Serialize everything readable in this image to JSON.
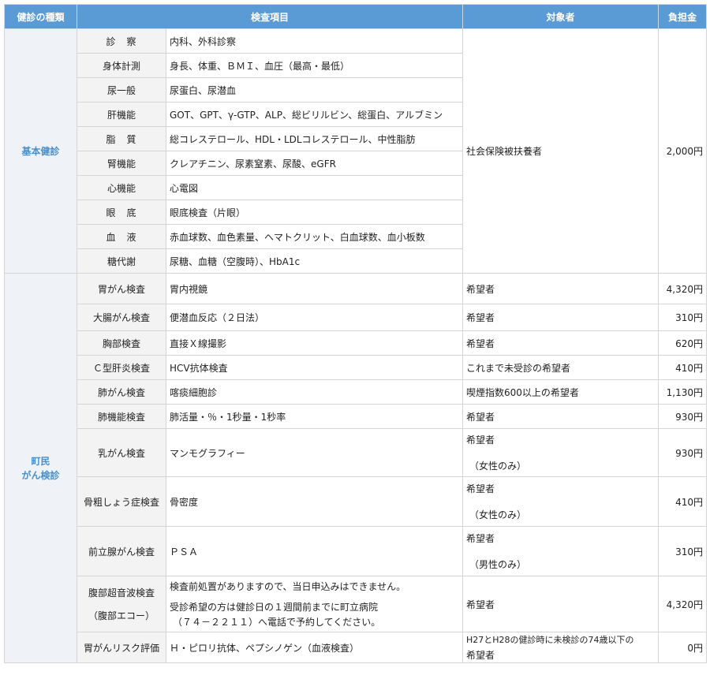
{
  "headers": {
    "type": "健診の種類",
    "item": "検査項目",
    "target": "対象者",
    "fee": "負担金"
  },
  "basic": {
    "category": "基本健診",
    "target": "社会保険被扶養者",
    "fee": "2,000円",
    "items": [
      {
        "name": "診　察",
        "detail": "内科、外科診察"
      },
      {
        "name": "身体計測",
        "detail": "身長、体重、ＢＭＩ、血圧（最高・最低）"
      },
      {
        "name": "尿一般",
        "detail": "尿蛋白、尿潜血"
      },
      {
        "name": "肝機能",
        "detail": "GOT、GPT、γ-GTP、ALP、総ビリルビン、総蛋白、アルブミン"
      },
      {
        "name": "脂　質",
        "detail": "総コレステロール、HDL・LDLコレステロール、中性脂肪"
      },
      {
        "name": "腎機能",
        "detail": "クレアチニン、尿素窒素、尿酸、eGFR"
      },
      {
        "name": "心機能",
        "detail": "心電図"
      },
      {
        "name": "眼　底",
        "detail": "眼底検査（片眼）"
      },
      {
        "name": "血　液",
        "detail": "赤血球数、血色素量、ヘマトクリット、白血球数、血小板数"
      },
      {
        "name": "糖代謝",
        "detail": "尿糖、血糖（空腹時）、HbA1c"
      }
    ]
  },
  "cancer": {
    "category_line1": "町民",
    "category_line2": "がん検診",
    "rows": [
      {
        "name": "胃がん検査",
        "detail": "胃内視鏡",
        "target": "希望者",
        "fee": "4,320円"
      },
      {
        "name": "大腸がん検査",
        "detail": "便潜血反応（２日法）",
        "target": "希望者",
        "fee": "310円"
      },
      {
        "name": "胸部検査",
        "detail": "直接Ｘ線撮影",
        "target": "希望者",
        "fee": "620円"
      },
      {
        "name": "Ｃ型肝炎検査",
        "detail": "HCV抗体検査",
        "target": "これまで未受診の希望者",
        "fee": "410円"
      },
      {
        "name": "肺がん検査",
        "detail": "喀痰細胞診",
        "target": "喫煙指数600以上の希望者",
        "fee": "1,130円"
      },
      {
        "name": "肺機能検査",
        "detail": "肺活量・％・1秒量・1秒率",
        "target": "希望者",
        "fee": "930円"
      },
      {
        "name": "乳がん検査",
        "detail": "マンモグラフィー",
        "target_line1": "希望者",
        "target_line2": "（女性のみ）",
        "fee": "930円"
      },
      {
        "name": "骨粗しょう症検査",
        "detail": "骨密度",
        "target_line1": "希望者",
        "target_line2": "（女性のみ）",
        "fee": "410円"
      },
      {
        "name": "前立腺がん検査",
        "detail": "ＰＳＡ",
        "target_line1": "希望者",
        "target_line2": "（男性のみ）",
        "fee": "310円"
      },
      {
        "name_line1": "腹部超音波検査",
        "name_line2": "（腹部エコー）",
        "detail_line1": "検査前処置がありますので、当日申込みはできません。",
        "detail_line2": "受診希望の方は健診日の１週間前までに町立病院",
        "detail_line3": "（７４－２２１１）へ電話で予約してください。",
        "target": "希望者",
        "fee": "4,320円"
      },
      {
        "name": "胃がんリスク評価",
        "detail": "Ｈ・ピロリ抗体、ペプシノゲン（血液検査）",
        "target_line1": "H27とH28の健診時に未検診の74歳以下の",
        "target_line2": "希望者",
        "fee": "0円"
      }
    ]
  }
}
